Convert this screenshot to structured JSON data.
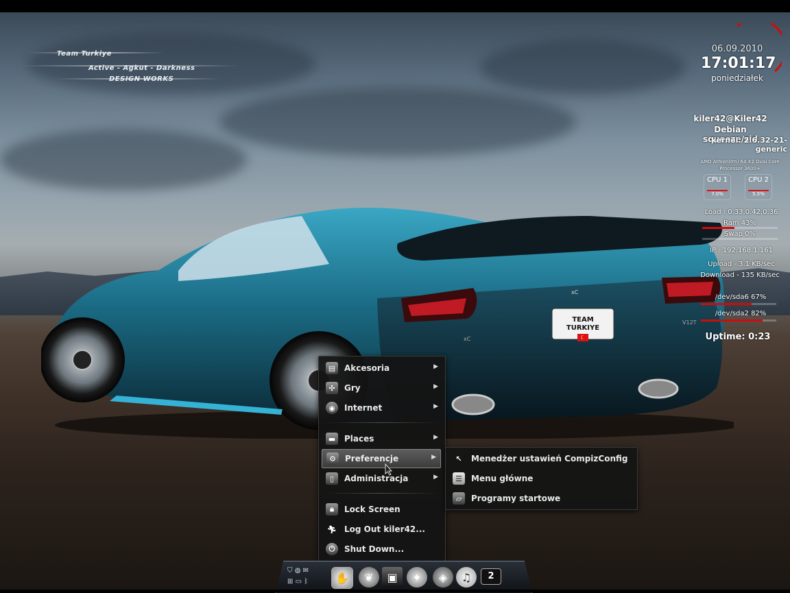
{
  "branding": {
    "line1": "Team Turkiye",
    "line2": "Active - Agkut - Darkness",
    "line3": "DESIGN WORKS"
  },
  "plate": {
    "line1": "TEAM",
    "line2": "TURKIYE"
  },
  "car_badge": "V12T",
  "car_logo": "xC",
  "clock": {
    "date": "06.09.2010",
    "time": "17:01:17",
    "weekday": "poniedziałek"
  },
  "sysinfo": {
    "user": "kiler42@Kiler42",
    "os": "Debian squeeze/sid",
    "kernel": "kernel: 2.6.32-21-generic",
    "cpu_model_1": "AMD Athlon(tm) 64 X2 Dual Core",
    "cpu_model_2": "Processor 3600+",
    "cpu1": {
      "label": "CPU 1",
      "value": "7.0%",
      "fraction": 0.07
    },
    "cpu2": {
      "label": "CPU 2",
      "value": "5.5%",
      "fraction": 0.055
    },
    "load": "Load : 0.33,0.42,0.36",
    "ram": {
      "text": "Ram 43%",
      "fraction": 0.43
    },
    "swap": {
      "text": "Swap 0%",
      "fraction": 0.0
    },
    "ip": "IP : 192.168.1.161",
    "upload": "Upload - 3.1 KB/sec",
    "download": "Download - 135 KB/sec",
    "sda6": {
      "text": "/dev/sda6 67%",
      "fraction": 0.67
    },
    "sda2": {
      "text": "/dev/sda2 82%",
      "fraction": 0.82
    },
    "uptime": "Uptime: 0:23"
  },
  "main_menu": {
    "items": [
      {
        "label": "Akcesoria",
        "icon": "accessories-icon",
        "submenu": true
      },
      {
        "label": "Gry",
        "icon": "gamepad-icon",
        "submenu": true
      },
      {
        "label": "Internet",
        "icon": "globe-icon",
        "submenu": true
      },
      {
        "label": "Places",
        "icon": "folder-icon",
        "submenu": true
      },
      {
        "label": "Preferencje",
        "icon": "preferences-icon",
        "submenu": true,
        "active": true
      },
      {
        "label": "Administracja",
        "icon": "admin-icon",
        "submenu": true
      },
      {
        "label": "Lock Screen",
        "icon": "lock-icon",
        "submenu": false
      },
      {
        "label": "Log Out kiler42...",
        "icon": "logout-icon",
        "submenu": false
      },
      {
        "label": "Shut Down...",
        "icon": "power-icon",
        "submenu": false
      }
    ]
  },
  "submenu_preferencje": {
    "items": [
      {
        "label": "Menedżer ustawień CompizConfig",
        "icon": "compiz-icon"
      },
      {
        "label": "Menu główne",
        "icon": "menu-editor-icon"
      },
      {
        "label": "Programy startowe",
        "icon": "startup-icon"
      }
    ]
  },
  "dock": {
    "workspace_number": "2"
  },
  "colors": {
    "accent": "#d10b0b",
    "menu_bg": "#141414",
    "car": "#1d6d84"
  }
}
